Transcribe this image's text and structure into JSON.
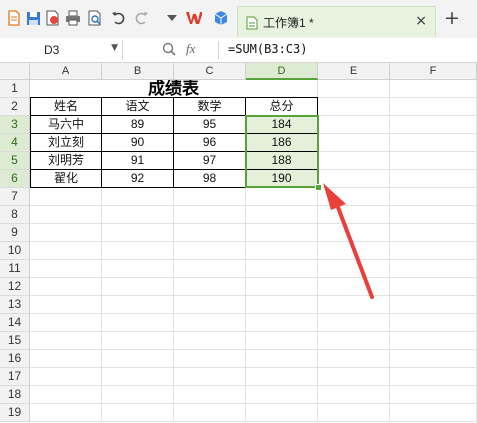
{
  "app": {
    "tab_title": "工作簿1 *",
    "tab_close": "×",
    "tab_add": "+"
  },
  "toolbar_icons": [
    "new-doc-icon",
    "save-icon",
    "export-pdf-icon",
    "print-icon",
    "print-preview-icon",
    "undo-icon",
    "redo-icon",
    "dropdown-icon",
    "wps-logo-icon",
    "cube-icon"
  ],
  "formula_bar": {
    "name_box": "D3",
    "fx": "fx",
    "formula": "=SUM(B3:C3)"
  },
  "sheet": {
    "columns": [
      "A",
      "B",
      "C",
      "D",
      "E",
      "F"
    ],
    "selected_column": "D",
    "rows": [
      "1",
      "2",
      "3",
      "4",
      "5",
      "6",
      "7",
      "8",
      "9",
      "10",
      "11",
      "12",
      "13",
      "14",
      "15",
      "16",
      "17",
      "18",
      "19"
    ],
    "selected_rows": [
      "3",
      "4",
      "5",
      "6"
    ],
    "title": "成绩表",
    "headers": [
      "姓名",
      "语文",
      "数学",
      "总分"
    ],
    "records": [
      [
        "马六中",
        "89",
        "95",
        "184"
      ],
      [
        "刘立刻",
        "90",
        "96",
        "186"
      ],
      [
        "刘明芳",
        "91",
        "97",
        "188"
      ],
      [
        "翟化",
        "92",
        "98",
        "190"
      ]
    ]
  },
  "colors": {
    "accent": "#58a23a",
    "selection_fill": "#e4f0da",
    "arrow": "#e8403a"
  }
}
